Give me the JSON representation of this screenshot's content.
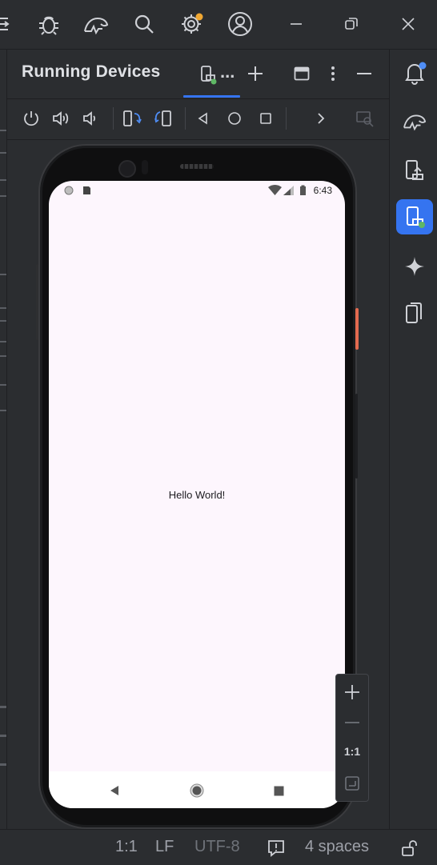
{
  "top_bar": {
    "icons": [
      "menu-icon",
      "bug-icon",
      "profiler-icon",
      "search-icon",
      "settings-icon",
      "account-icon"
    ],
    "window_controls": [
      "minimize-icon",
      "restore-icon",
      "close-icon"
    ]
  },
  "panel": {
    "title": "Running Devices",
    "tab_ellipsis": "...",
    "header_actions": [
      "add-icon",
      "layout-icon",
      "more-icon",
      "hide-icon"
    ]
  },
  "toolbar": {
    "buttons": [
      "power-icon",
      "volume-up-icon",
      "volume-down-icon",
      "rotate-left-icon",
      "rotate-right-icon",
      "back-icon",
      "home-icon",
      "overview-icon",
      "expand-icon",
      "screenshot-icon"
    ]
  },
  "device": {
    "status_time": "6:43",
    "app_text": "Hello World!"
  },
  "zoom": {
    "one_to_one": "1:1"
  },
  "right_strip": {
    "icons": [
      "notifications-icon",
      "app-inspection-icon",
      "device-manager-icon",
      "running-devices-icon",
      "gemini-icon",
      "device-explorer-icon"
    ]
  },
  "status_bar": {
    "position": "1:1",
    "line_ending": "LF",
    "encoding": "UTF-8",
    "indent": "4 spaces"
  },
  "colors": {
    "accent": "#3574f0",
    "background": "#2b2d30",
    "screen": "#fdf6fd",
    "notification_dot": "#f0a732",
    "power_button": "#e36a4f"
  }
}
